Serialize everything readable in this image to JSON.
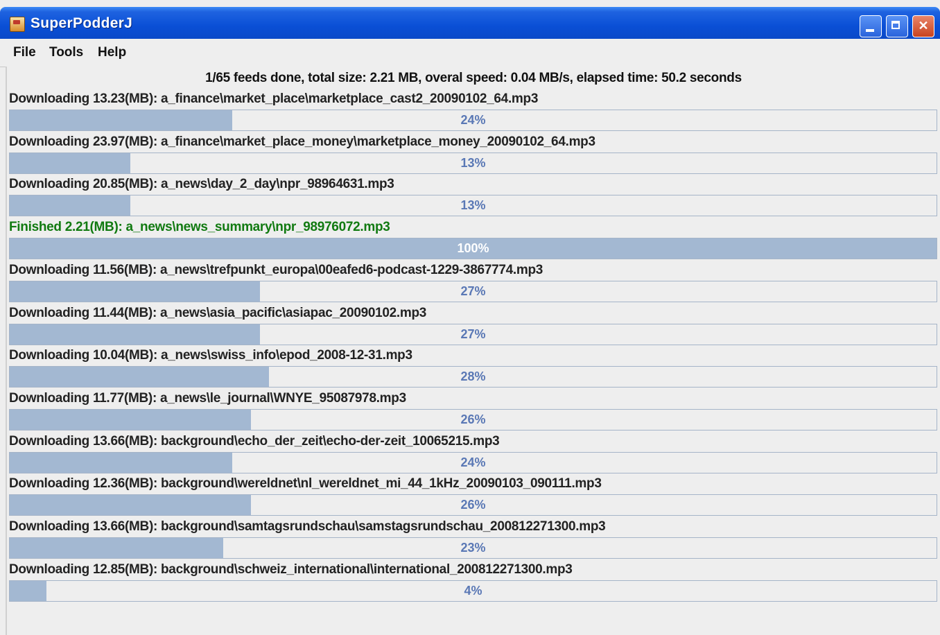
{
  "window": {
    "title": "SuperPodderJ"
  },
  "menu": [
    "File",
    "Tools",
    "Help"
  ],
  "summary": "1/65 feeds done, total size: 2.21 MB, overal speed: 0.04 MB/s, elapsed time: 50.2 seconds",
  "colors": {
    "titlebar": "#0a4fd6",
    "progress_fill": "#a3b8d2",
    "percent_text": "#5a78b5",
    "finished_text": "#117a11"
  },
  "downloads": [
    {
      "label": "Downloading 13.23(MB): a_finance\\market_place\\marketplace_cast2_20090102_64.mp3",
      "progress": 24,
      "percent_text": "24%",
      "status": "downloading"
    },
    {
      "label": "Downloading 23.97(MB): a_finance\\market_place_money\\marketplace_money_20090102_64.mp3",
      "progress": 13,
      "percent_text": "13%",
      "status": "downloading"
    },
    {
      "label": "Downloading 20.85(MB): a_news\\day_2_day\\npr_98964631.mp3",
      "progress": 13,
      "percent_text": "13%",
      "status": "downloading"
    },
    {
      "label": "Finished 2.21(MB): a_news\\news_summary\\npr_98976072.mp3",
      "progress": 100,
      "percent_text": "100%",
      "status": "finished"
    },
    {
      "label": "Downloading 11.56(MB): a_news\\trefpunkt_europa\\00eafed6-podcast-1229-3867774.mp3",
      "progress": 27,
      "percent_text": "27%",
      "status": "downloading"
    },
    {
      "label": "Downloading 11.44(MB): a_news\\asia_pacific\\asiapac_20090102.mp3",
      "progress": 27,
      "percent_text": "27%",
      "status": "downloading"
    },
    {
      "label": "Downloading 10.04(MB): a_news\\swiss_info\\epod_2008-12-31.mp3",
      "progress": 28,
      "percent_text": "28%",
      "status": "downloading"
    },
    {
      "label": "Downloading 11.77(MB): a_news\\le_journal\\WNYE_95087978.mp3",
      "progress": 26,
      "percent_text": "26%",
      "status": "downloading"
    },
    {
      "label": "Downloading 13.66(MB): background\\echo_der_zeit\\echo-der-zeit_10065215.mp3",
      "progress": 24,
      "percent_text": "24%",
      "status": "downloading"
    },
    {
      "label": "Downloading 12.36(MB): background\\wereldnet\\nl_wereldnet_mi_44_1kHz_20090103_090111.mp3",
      "progress": 26,
      "percent_text": "26%",
      "status": "downloading"
    },
    {
      "label": "Downloading 13.66(MB): background\\samtagsrundschau\\samstagsrundschau_200812271300.mp3",
      "progress": 23,
      "percent_text": "23%",
      "status": "downloading"
    },
    {
      "label": "Downloading 12.85(MB): background\\schweiz_international\\international_200812271300.mp3",
      "progress": 4,
      "percent_text": "4%",
      "status": "downloading"
    }
  ]
}
